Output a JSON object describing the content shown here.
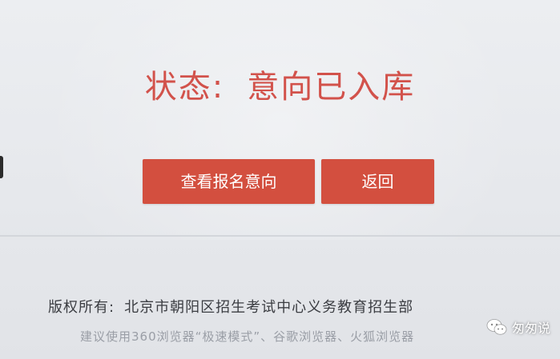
{
  "status": {
    "label": "状态:",
    "value": "意向已入库"
  },
  "actions": {
    "view_label": "查看报名意向",
    "back_label": "返回"
  },
  "footer": {
    "copyright_label": "版权所有:",
    "copyright_owner": "北京市朝阳区招生考试中心义务教育招生部",
    "browser_hint": "建议使用360浏览器“极速模式”、谷歌浏览器、火狐浏览器"
  },
  "watermark": {
    "text": "匆匆说",
    "icon": "wechat-icon"
  },
  "colors": {
    "accent": "#d34f3f",
    "status_text": "#d2524b",
    "background": "#e8eaed"
  }
}
